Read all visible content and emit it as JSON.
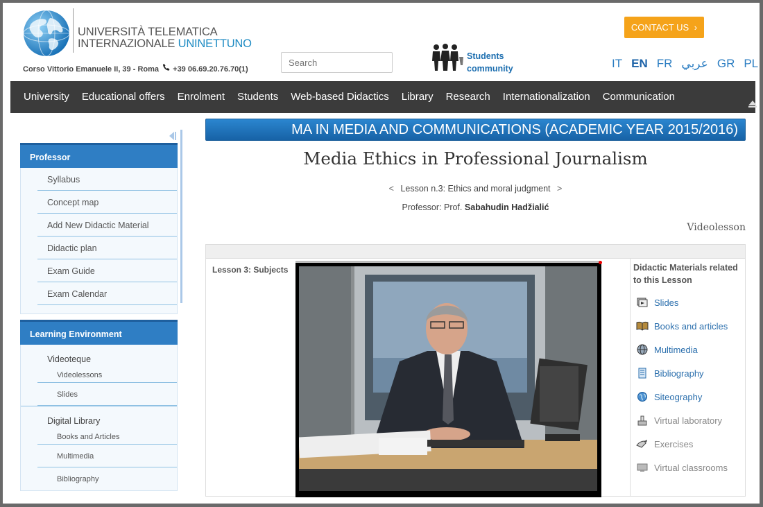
{
  "header": {
    "uni_line1": "UNIVERSITÀ TELEMATICA",
    "uni_line2a": "INTERNAZIONALE ",
    "uni_line2b": "UNINETTUNO",
    "address": "Corso Vittorio Emanuele II, 39 - Roma",
    "phone": "+39 06.69.20.76.70(1)",
    "search_placeholder": "Search",
    "community_line1": "Students",
    "community_line2": "community",
    "contact_label": "CONTACT US",
    "contact_arrow": "›",
    "languages": [
      "IT",
      "EN",
      "FR",
      "عربي",
      "GR",
      "PL"
    ],
    "active_language": "EN"
  },
  "nav": {
    "items": [
      "University",
      "Educational offers",
      "Enrolment",
      "Students",
      "Web-based Didactics",
      "Library",
      "Research",
      "Internationalization",
      "Communication"
    ]
  },
  "sidebar": {
    "professor_title": "Professor",
    "professor_items": [
      "Syllabus",
      "Concept map",
      "Add New Didactic Material",
      "Didactic plan",
      "Exam Guide",
      "Exam Calendar"
    ],
    "learning_title": "Learning Environment",
    "videoteque": "Videoteque",
    "videoteque_items": [
      "Videolessons",
      "Slides"
    ],
    "digital_library": "Digital Library",
    "digital_library_items": [
      "Books and Articles",
      "Multimedia",
      "Bibliography"
    ]
  },
  "main": {
    "course_banner": "MA IN MEDIA AND COMMUNICATIONS (ACADEMIC YEAR 2015/2016)",
    "course_title": "Media Ethics in Professional Journalism",
    "lesson_prev": "<",
    "lesson_label": "Lesson n.3: Ethics and moral judgment",
    "lesson_next": ">",
    "professor_prefix": "Professor: Prof.",
    "professor_name": "Sabahudin Hadžialić",
    "videolesson_label": "Videolesson",
    "lesson_subjects": "Lesson 3: Subjects",
    "didactic_head": "Didactic Materials related to this Lesson",
    "didactic_items": [
      {
        "label": "Slides",
        "icon": "slides-icon",
        "enabled": true
      },
      {
        "label": "Books and articles",
        "icon": "book-icon",
        "enabled": true
      },
      {
        "label": "Multimedia",
        "icon": "globe-icon",
        "enabled": true
      },
      {
        "label": "Bibliography",
        "icon": "bibliography-icon",
        "enabled": true
      },
      {
        "label": "Siteography",
        "icon": "siteography-icon",
        "enabled": true
      },
      {
        "label": "Virtual laboratory",
        "icon": "lab-icon",
        "enabled": false
      },
      {
        "label": "Exercises",
        "icon": "exercises-icon",
        "enabled": false
      },
      {
        "label": "Virtual classrooms",
        "icon": "classroom-icon",
        "enabled": false
      }
    ]
  },
  "colors": {
    "accent_orange": "#f5a31a",
    "nav_bg": "#3b3b3b",
    "brand_blue": "#1e8bc3",
    "sidebar_head": "#2f7ec4"
  }
}
